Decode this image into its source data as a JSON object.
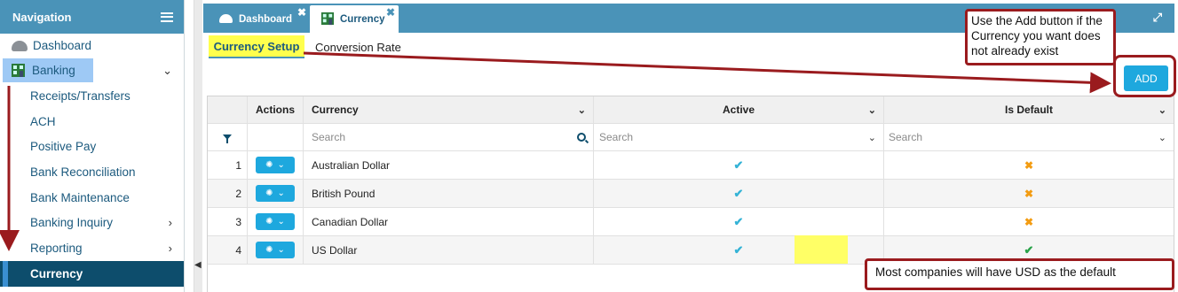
{
  "sidebar": {
    "title": "Navigation",
    "items": [
      {
        "label": "Dashboard"
      },
      {
        "label": "Banking"
      },
      {
        "label": "Receipts/Transfers"
      },
      {
        "label": "ACH"
      },
      {
        "label": "Positive Pay"
      },
      {
        "label": "Bank Reconciliation"
      },
      {
        "label": "Bank Maintenance"
      },
      {
        "label": "Banking Inquiry"
      },
      {
        "label": "Reporting"
      },
      {
        "label": "Currency"
      }
    ]
  },
  "tabs": [
    {
      "label": "Dashboard",
      "icon": "speedometer-icon"
    },
    {
      "label": "Currency",
      "icon": "bank-building-icon"
    }
  ],
  "subtabs": {
    "currency_setup": "Currency Setup",
    "conversion_rate": "Conversion Rate"
  },
  "toolbar": {
    "add_label": "ADD"
  },
  "grid": {
    "columns": [
      "Actions",
      "Currency",
      "Active",
      "Is Default"
    ],
    "filter_placeholder": "Search",
    "rows": [
      {
        "num": "1",
        "currency": "Australian Dollar",
        "active": true,
        "is_default": false
      },
      {
        "num": "2",
        "currency": "British Pound",
        "active": true,
        "is_default": false
      },
      {
        "num": "3",
        "currency": "Canadian Dollar",
        "active": true,
        "is_default": false
      },
      {
        "num": "4",
        "currency": "US Dollar",
        "active": true,
        "is_default": true
      }
    ]
  },
  "annotations": {
    "add_note": "Use the Add button if the Currency you want does not already exist",
    "usd_note": "Most companies will have USD as the default"
  },
  "colors": {
    "header": "#4a93b8",
    "accent": "#1ea8de",
    "selected_nav": "#0d4d6c",
    "annotation": "#9a1b1e",
    "highlight": "#ffff4d"
  }
}
